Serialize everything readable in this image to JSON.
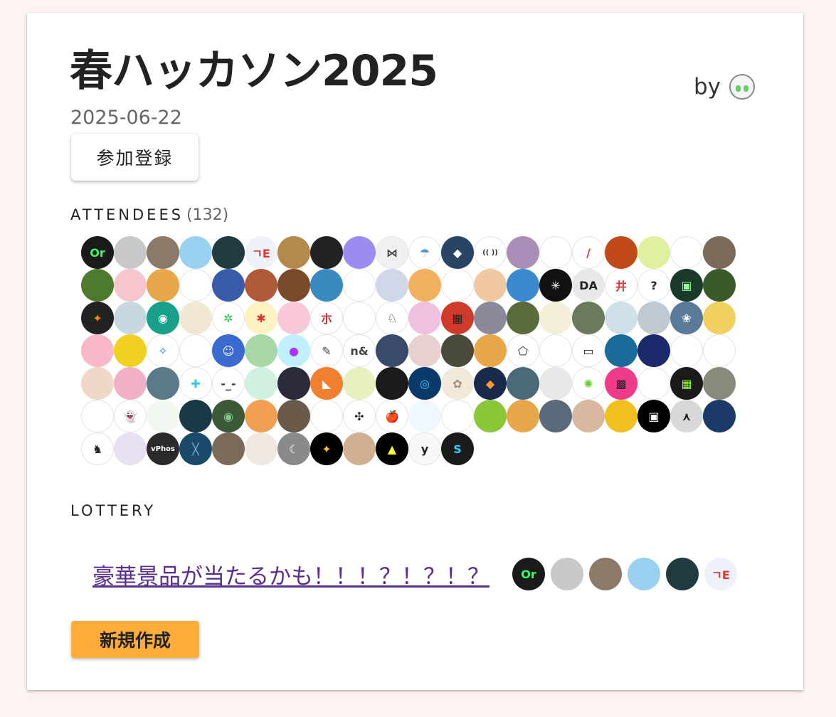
{
  "event": {
    "title": "春ハッカソン2025",
    "by_label": "by",
    "date": "2025-06-22",
    "join_label": "参加登録"
  },
  "attendees": {
    "label": "ATTENDEES",
    "count": "(132)",
    "avatars": [
      {
        "bg": "#1a1a1a",
        "fg": "#33ff66",
        "t": "Or"
      },
      {
        "bg": "#c8c8c8",
        "fg": "#999",
        "t": ""
      },
      {
        "bg": "#8b7a6a",
        "fg": "#fff",
        "t": ""
      },
      {
        "bg": "#9ad0f0",
        "fg": "#1c6fc4",
        "t": ""
      },
      {
        "bg": "#1f3b40",
        "fg": "#dfe",
        "t": ""
      },
      {
        "bg": "#eef2f8",
        "fg": "#d33",
        "t": "ㄱE"
      },
      {
        "bg": "#b48a4a",
        "fg": "#fff",
        "t": ""
      },
      {
        "bg": "#222",
        "fg": "#ccc",
        "t": ""
      },
      {
        "bg": "#9b8cf0",
        "fg": "#fff",
        "t": ""
      },
      {
        "bg": "#f0f0f0",
        "fg": "#444",
        "t": "⋈"
      },
      {
        "bg": "#ffffff",
        "fg": "#59c",
        "t": "☂"
      },
      {
        "bg": "#2a4466",
        "fg": "#fff",
        "t": "◆"
      },
      {
        "bg": "#ffffff",
        "fg": "#333",
        "t": "(( ))"
      },
      {
        "bg": "#a98fb8",
        "fg": "#222",
        "t": ""
      },
      {
        "bg": "#ffffff",
        "fg": "#666",
        "t": ""
      },
      {
        "bg": "#ffffff",
        "fg": "#d33",
        "t": "/"
      },
      {
        "bg": "#c04a1a",
        "fg": "#fd6",
        "t": ""
      },
      {
        "bg": "#dff0a0",
        "fg": "#a66",
        "t": ""
      },
      {
        "bg": "#ffffff",
        "fg": "#38f",
        "t": ""
      },
      {
        "bg": "#7a6a5a",
        "fg": "#fff",
        "t": ""
      },
      {
        "bg": "#4d7a2e",
        "fg": "#ad8",
        "t": ""
      },
      {
        "bg": "#f6c6cf",
        "fg": "#a66",
        "t": ""
      },
      {
        "bg": "#e8a84a",
        "fg": "#fff",
        "t": ""
      },
      {
        "bg": "#ffffff",
        "fg": "#2a2",
        "t": ""
      },
      {
        "bg": "#3a5aaa",
        "fg": "#aef",
        "t": ""
      },
      {
        "bg": "#b05a3a",
        "fg": "#fff",
        "t": ""
      },
      {
        "bg": "#7a4a2a",
        "fg": "#fff",
        "t": ""
      },
      {
        "bg": "#3a8ac0",
        "fg": "#fff",
        "t": ""
      },
      {
        "bg": "#ffffff",
        "fg": "#222",
        "t": ""
      },
      {
        "bg": "#d0d8e8",
        "fg": "#222",
        "t": ""
      },
      {
        "bg": "#f0b060",
        "fg": "#fff",
        "t": ""
      },
      {
        "bg": "#ffffff",
        "fg": "#fd2",
        "t": ""
      },
      {
        "bg": "#f0c8a0",
        "fg": "#333",
        "t": ""
      },
      {
        "bg": "#3a8ad0",
        "fg": "#fff",
        "t": ""
      },
      {
        "bg": "#111",
        "fg": "#fff",
        "t": "✳"
      },
      {
        "bg": "#e8e8e8",
        "fg": "#222",
        "t": "DA"
      },
      {
        "bg": "#ffffff",
        "fg": "#d33",
        "t": "井"
      },
      {
        "bg": "#ffffff",
        "fg": "#222",
        "t": "?"
      },
      {
        "bg": "#1a3a2a",
        "fg": "#9f9",
        "t": "▣"
      },
      {
        "bg": "#3a5a2a",
        "fg": "#fd6",
        "t": ""
      },
      {
        "bg": "#222",
        "fg": "#f80",
        "t": "✦"
      },
      {
        "bg": "#c8d8e0",
        "fg": "#666",
        "t": ""
      },
      {
        "bg": "#18a08a",
        "fg": "#fff",
        "t": "◉"
      },
      {
        "bg": "#f0e8d0",
        "fg": "#a73",
        "t": ""
      },
      {
        "bg": "#ffffff",
        "fg": "#2b4",
        "t": "✲"
      },
      {
        "bg": "#fdf2c0",
        "fg": "#d33",
        "t": "✱"
      },
      {
        "bg": "#f8c8d8",
        "fg": "#c36",
        "t": ""
      },
      {
        "bg": "#ffffff",
        "fg": "#b33",
        "t": "朩"
      },
      {
        "bg": "#ffffff",
        "fg": "#c22",
        "t": ""
      },
      {
        "bg": "#ffffff",
        "fg": "#222",
        "t": "♘"
      },
      {
        "bg": "#f0c0e0",
        "fg": "#fff",
        "t": ""
      },
      {
        "bg": "#d03a2a",
        "fg": "#222",
        "t": "▦"
      },
      {
        "bg": "#8a8a9a",
        "fg": "#fff",
        "t": ""
      },
      {
        "bg": "#5a6a3a",
        "fg": "#fff",
        "t": ""
      },
      {
        "bg": "#f4f0d8",
        "fg": "#333",
        "t": ""
      },
      {
        "bg": "#6a7a5a",
        "fg": "#fff",
        "t": ""
      },
      {
        "bg": "#d0e0e8",
        "fg": "#555",
        "t": ""
      },
      {
        "bg": "#c0c8d0",
        "fg": "#222",
        "t": ""
      },
      {
        "bg": "#5a7a9a",
        "fg": "#fff",
        "t": "❀"
      },
      {
        "bg": "#f0d060",
        "fg": "#c33",
        "t": ""
      },
      {
        "bg": "#f8b8c8",
        "fg": "#c36",
        "t": ""
      },
      {
        "bg": "#f0d020",
        "fg": "#c33",
        "t": ""
      },
      {
        "bg": "#ffffff",
        "fg": "#28f",
        "t": "✧"
      },
      {
        "bg": "#ffffff",
        "fg": "#d44",
        "t": ""
      },
      {
        "bg": "#3a6ad0",
        "fg": "#fff",
        "t": "☺"
      },
      {
        "bg": "#a8d8a8",
        "fg": "#fff",
        "t": ""
      },
      {
        "bg": "#c0f0ff",
        "fg": "#a3f",
        "t": "●"
      },
      {
        "bg": "#ffffff",
        "fg": "#444",
        "t": "✎"
      },
      {
        "bg": "#ffffff",
        "fg": "#444",
        "t": "n&"
      },
      {
        "bg": "#3a4a6a",
        "fg": "#ccd",
        "t": ""
      },
      {
        "bg": "#e8d0d0",
        "fg": "#555",
        "t": ""
      },
      {
        "bg": "#4a4a3a",
        "fg": "#ccc",
        "t": ""
      },
      {
        "bg": "#e8a84a",
        "fg": "#fff",
        "t": ""
      },
      {
        "bg": "#ffffff",
        "fg": "#222",
        "t": "⬠"
      },
      {
        "bg": "#ffffff",
        "fg": "#39c",
        "t": ""
      },
      {
        "bg": "#ffffff",
        "fg": "#222",
        "t": "▭"
      },
      {
        "bg": "#1a6a9a",
        "fg": "#8cf",
        "t": ""
      },
      {
        "bg": "#1a2a6a",
        "fg": "#6af",
        "t": ""
      },
      {
        "bg": "#ffffff",
        "fg": "#666",
        "t": ""
      },
      {
        "bg": "#ffffff",
        "fg": "#c33",
        "t": ""
      },
      {
        "bg": "#f0d8c8",
        "fg": "#643",
        "t": ""
      },
      {
        "bg": "#f0b0c8",
        "fg": "#c36",
        "t": ""
      },
      {
        "bg": "#5a7a8a",
        "fg": "#fff",
        "t": ""
      },
      {
        "bg": "#ffffff",
        "fg": "#3cd",
        "t": "✚"
      },
      {
        "bg": "#ffffff",
        "fg": "#444",
        "t": "-_-"
      },
      {
        "bg": "#d0f0e0",
        "fg": "#3a8",
        "t": ""
      },
      {
        "bg": "#2a2a3a",
        "fg": "#fff",
        "t": ""
      },
      {
        "bg": "#f08030",
        "fg": "#fff",
        "t": "◣"
      },
      {
        "bg": "#e8f0c0",
        "fg": "#c93",
        "t": ""
      },
      {
        "bg": "#1a1a1a",
        "fg": "#ca8",
        "t": ""
      },
      {
        "bg": "#0a3a6a",
        "fg": "#3cf",
        "t": "◎"
      },
      {
        "bg": "#f0e8d8",
        "fg": "#a87",
        "t": "✿"
      },
      {
        "bg": "#1a2a4a",
        "fg": "#f93",
        "t": "◆"
      },
      {
        "bg": "#4a6a7a",
        "fg": "#fff",
        "t": ""
      },
      {
        "bg": "#e8e8e8",
        "fg": "#fff",
        "t": ""
      },
      {
        "bg": "#ffffff",
        "fg": "#6c3",
        "t": "✺"
      },
      {
        "bg": "#f03a8a",
        "fg": "#222",
        "t": "▩"
      },
      {
        "bg": "#ffffff",
        "fg": "#229",
        "t": ""
      },
      {
        "bg": "#1a1a1a",
        "fg": "#9f3",
        "t": "▦"
      },
      {
        "bg": "#8a8a7a",
        "fg": "#ddd",
        "t": ""
      },
      {
        "bg": "#ffffff",
        "fg": "#5bd",
        "t": ""
      },
      {
        "bg": "#ffffff",
        "fg": "#222",
        "t": "👻"
      },
      {
        "bg": "#f0f8f0",
        "fg": "#3a5",
        "t": ""
      },
      {
        "bg": "#1a3a4a",
        "fg": "#9df",
        "t": ""
      },
      {
        "bg": "#3a5a3a",
        "fg": "#8c8",
        "t": "◉"
      },
      {
        "bg": "#f0a050",
        "fg": "#fff",
        "t": ""
      },
      {
        "bg": "#6a5a4a",
        "fg": "#eee",
        "t": ""
      },
      {
        "bg": "#ffffff",
        "fg": "#36c",
        "t": ""
      },
      {
        "bg": "#ffffff",
        "fg": "#222",
        "t": "✣"
      },
      {
        "bg": "#ffffff",
        "fg": "#d22",
        "t": "🍎"
      },
      {
        "bg": "#f0f8ff",
        "fg": "#38c",
        "t": ""
      },
      {
        "bg": "#ffffff",
        "fg": "#d33",
        "t": ""
      },
      {
        "bg": "#8ac83a",
        "fg": "#fff",
        "t": ""
      },
      {
        "bg": "#e8a84a",
        "fg": "#fff",
        "t": ""
      },
      {
        "bg": "#5a6a7a",
        "fg": "#fff",
        "t": ""
      },
      {
        "bg": "#d8b8a0",
        "fg": "#643",
        "t": ""
      },
      {
        "bg": "#f0c020",
        "fg": "#c33",
        "t": ""
      },
      {
        "bg": "#000000",
        "fg": "#fff",
        "t": "▣"
      },
      {
        "bg": "#d8d8d8",
        "fg": "#222",
        "t": "⋏"
      },
      {
        "bg": "#1a3a6a",
        "fg": "#eef",
        "t": ""
      },
      {
        "bg": "#ffffff",
        "fg": "#222",
        "t": "♞"
      },
      {
        "bg": "#e8e0f0",
        "fg": "#77a",
        "t": ""
      },
      {
        "bg": "#2a2a2a",
        "fg": "#fff",
        "t": "vPhos"
      },
      {
        "bg": "#1a4a6a",
        "fg": "#8ac",
        "t": "╳"
      },
      {
        "bg": "#7a6a5a",
        "fg": "#eee",
        "t": ""
      },
      {
        "bg": "#f0e8e0",
        "fg": "#777",
        "t": ""
      },
      {
        "bg": "#8a8a8a",
        "fg": "#fff",
        "t": "☾"
      },
      {
        "bg": "#000000",
        "fg": "#fb3",
        "t": "✦"
      },
      {
        "bg": "#d0b090",
        "fg": "#643",
        "t": ""
      },
      {
        "bg": "#000000",
        "fg": "#ff3",
        "t": "▲"
      },
      {
        "bg": "#f8f8f8",
        "fg": "#222",
        "t": "y"
      },
      {
        "bg": "#1a1a1a",
        "fg": "#3cf",
        "t": "S"
      }
    ]
  },
  "lottery": {
    "label": "LOTTERY",
    "link_text": "豪華景品が当たるかも！！！？！？！？",
    "avatars": [
      {
        "bg": "#1a1a1a",
        "fg": "#33ff66",
        "t": "Or"
      },
      {
        "bg": "#c8c8c8",
        "fg": "#999",
        "t": ""
      },
      {
        "bg": "#8b7a6a",
        "fg": "#fff",
        "t": ""
      },
      {
        "bg": "#9ad0f0",
        "fg": "#1c6fc4",
        "t": ""
      },
      {
        "bg": "#1f3b40",
        "fg": "#dfe",
        "t": ""
      },
      {
        "bg": "#eef2f8",
        "fg": "#d33",
        "t": "ㄱE"
      }
    ]
  },
  "actions": {
    "new_label": "新規作成"
  },
  "colors": {
    "page_bg": "#fdf3f1",
    "new_button": "#ffad3a",
    "link": "#5a2d91"
  },
  "icons": {
    "owner_avatar": "anime-girl-avatar-icon"
  }
}
